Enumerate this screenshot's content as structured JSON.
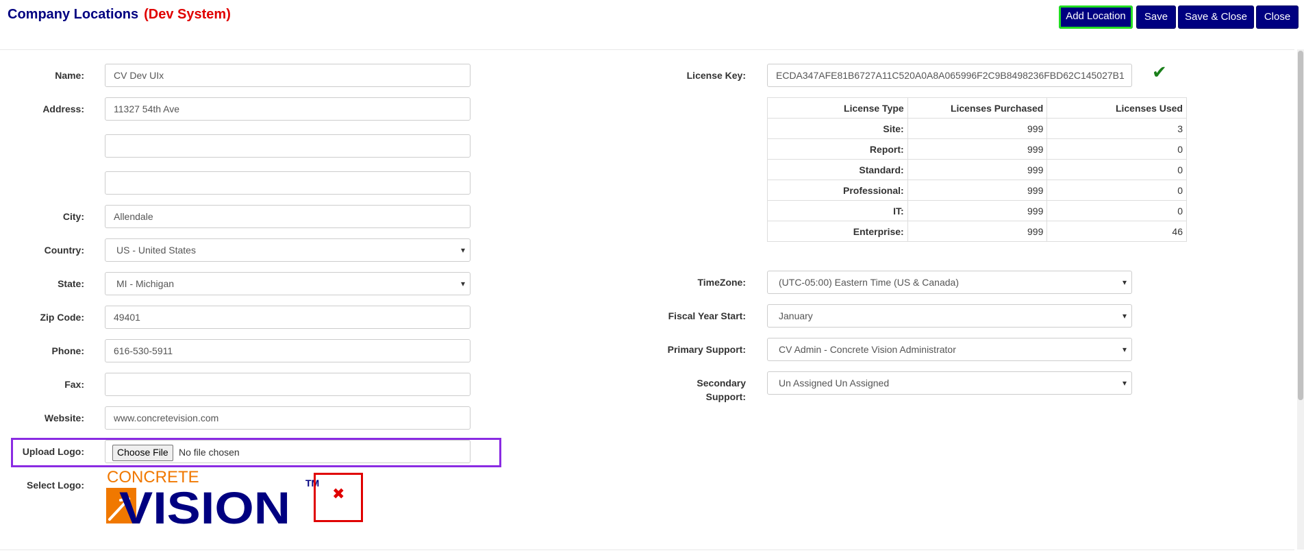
{
  "header": {
    "title": "Company Locations",
    "env_tag": "(Dev System)"
  },
  "toolbar": {
    "add_location": "Add Location",
    "save": "Save",
    "save_close": "Save & Close",
    "close": "Close"
  },
  "form": {
    "name_label": "Name:",
    "name_value": "CV Dev UIx",
    "address_label": "Address:",
    "address1": "11327 54th Ave",
    "address2": "",
    "address3": "",
    "city_label": "City:",
    "city_value": "Allendale",
    "country_label": "Country:",
    "country_value": "US - United States",
    "state_label": "State:",
    "state_value": "MI - Michigan",
    "zip_label": "Zip Code:",
    "zip_value": "49401",
    "phone_label": "Phone:",
    "phone_value": "616-530-5911",
    "fax_label": "Fax:",
    "fax_value": "",
    "website_label": "Website:",
    "website_value": "www.concretevision.com",
    "upload_label": "Upload Logo:",
    "choose_file": "Choose File",
    "no_file": "No file chosen",
    "select_logo_label": "Select Logo:",
    "logo_text_top": "CONCRETE",
    "logo_text_main": "VISION",
    "logo_tm": "TM",
    "remove_icon": "close-icon"
  },
  "license": {
    "key_label": "License Key:",
    "key_value": "ECDA347AFE81B6727A11C520A0A8A065996F2C9B8498236FBD62C145027B1",
    "valid_icon": "checkmark-icon",
    "columns": [
      "License Type",
      "Licenses Purchased",
      "Licenses Used"
    ],
    "rows": [
      {
        "type": "Site:",
        "purchased": "999",
        "used": "3"
      },
      {
        "type": "Report:",
        "purchased": "999",
        "used": "0"
      },
      {
        "type": "Standard:",
        "purchased": "999",
        "used": "0"
      },
      {
        "type": "Professional:",
        "purchased": "999",
        "used": "0"
      },
      {
        "type": "IT:",
        "purchased": "999",
        "used": "0"
      },
      {
        "type": "Enterprise:",
        "purchased": "999",
        "used": "46"
      }
    ]
  },
  "settings": {
    "timezone_label": "TimeZone:",
    "timezone_value": "(UTC-05:00) Eastern Time (US & Canada)",
    "fiscal_label": "Fiscal Year Start:",
    "fiscal_value": "January",
    "primary_label": "Primary Support:",
    "primary_value": "CV Admin - Concrete Vision Administrator",
    "secondary_label_1": "Secondary",
    "secondary_label_2": "Support:",
    "secondary_value": "Un Assigned Un Assigned"
  },
  "colors": {
    "brand_navy": "#000080",
    "dev_red": "#e00000",
    "highlight_green": "#22dd22",
    "highlight_purple": "#8a2be2",
    "logo_orange": "#f07800"
  }
}
